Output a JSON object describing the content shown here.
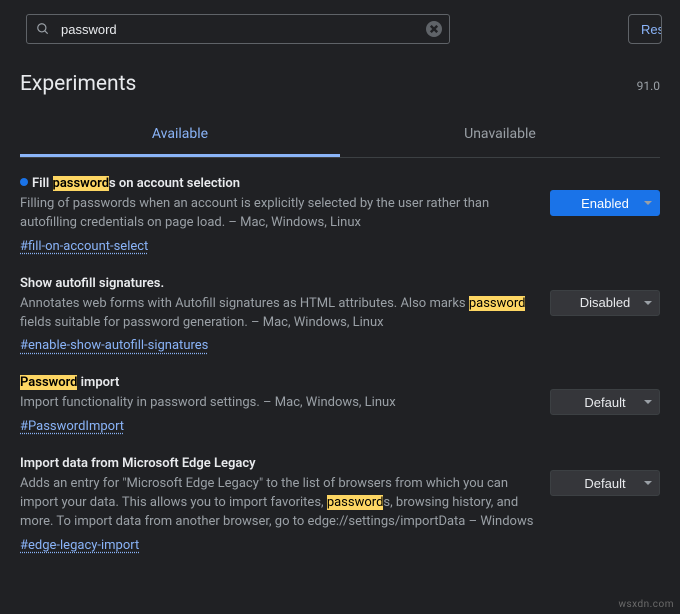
{
  "search": {
    "value": "password"
  },
  "reset_label": "Reset all",
  "page_title": "Experiments",
  "version": "91.0",
  "tabs": {
    "available": "Available",
    "unavailable": "Unavailable"
  },
  "options": {
    "enabled": "Enabled",
    "disabled": "Disabled",
    "default": "Default"
  },
  "experiments": [
    {
      "title_pre": "Fill ",
      "title_hl": "password",
      "title_post": "s on account selection",
      "desc": "Filling of passwords when an account is explicitly selected by the user rather than autofilling credentials on page load. – Mac, Windows, Linux",
      "hash": "#fill-on-account-select",
      "state": "Enabled",
      "bullet": true
    },
    {
      "title_pre": "Show autofill signatures.",
      "title_hl": "",
      "title_post": "",
      "desc_pre": "Annotates web forms with Autofill signatures as HTML attributes. Also marks ",
      "desc_hl": "password",
      "desc_post": " fields suitable for password generation. – Mac, Windows, Linux",
      "hash": "#enable-show-autofill-signatures",
      "state": "Disabled"
    },
    {
      "title_pre": "",
      "title_hl": "Password",
      "title_post": " import",
      "desc": "Import functionality in password settings. – Mac, Windows, Linux",
      "hash": "#PasswordImport",
      "state": "Default"
    },
    {
      "title_pre": "Import data from Microsoft Edge Legacy",
      "title_hl": "",
      "title_post": "",
      "desc_pre": "Adds an entry for \"Microsoft Edge Legacy\" to the list of browsers from which you can import your data. This allows you to import favorites, ",
      "desc_hl": "password",
      "desc_post": "s, browsing history, and more. To import data from another browser, go to edge://settings/importData – Windows",
      "hash": "#edge-legacy-import",
      "state": "Default"
    }
  ],
  "watermark": "wsxdn.com"
}
